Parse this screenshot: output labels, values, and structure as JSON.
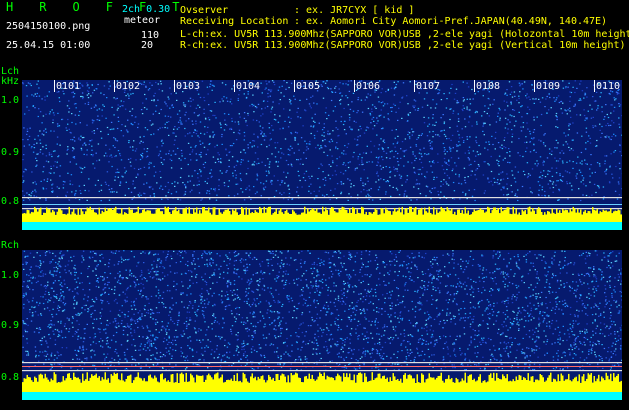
{
  "header": {
    "title": "H R O F F T",
    "filename": "2504150100.png",
    "datetime": "25.04.15 01:00",
    "mode": "2ch 0.30",
    "type": "meteor",
    "count_l": "110",
    "count_r": "20",
    "observer_label": "Ovserver",
    "observer_value": ": ex. JR7CYX [ kid ]",
    "location_label": "Receiving Location",
    "location_value": ": ex. Aomori City Aomori-Pref.JAPAN(40.49N, 140.47E)",
    "lch_info": "L-ch:ex. UV5R 113.900Mhz(SAPPORO VOR)USB ,2-ele yagi (Holozontal 10m height)",
    "rch_info": "R-ch:ex. UV5R 113.900Mhz(SAPPORO VOR)USB ,2-ele yagi (Vertical 10m height)"
  },
  "lch": {
    "label": "Lch",
    "unit": "kHz",
    "yticks": [
      "1.0",
      "0.9",
      "0.8"
    ],
    "time_labels": [
      "0101",
      "0102",
      "0103",
      "0104",
      "0105",
      "0106",
      "0107",
      "0108",
      "0109",
      "0110"
    ]
  },
  "rch": {
    "label": "Rch",
    "yticks": [
      "1.0",
      "0.9",
      "0.8"
    ]
  },
  "colors": {
    "background": "#000000",
    "spectrogram": "#061a6e",
    "signal": "#00ffff",
    "meteor_bar": "#ffff00",
    "label_green": "#00ff00"
  }
}
